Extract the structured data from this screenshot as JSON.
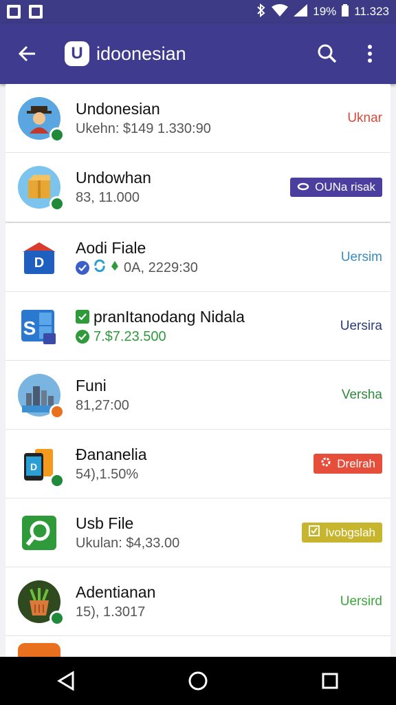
{
  "status_bar": {
    "battery": "19%",
    "time": "11.323"
  },
  "header": {
    "logo_letter": "U",
    "title": "idoonesian"
  },
  "list": [
    {
      "title": "Undonesian",
      "subtitle": "Ukehn: $149 1.330:90",
      "action": "Uknar",
      "action_style": "text",
      "action_color": "#d84a3a",
      "avatar_icon": "person-hat-icon",
      "status_color": "#1f8a3a"
    },
    {
      "title": "Undowhan",
      "subtitle": "83, 11.000",
      "action": "OUNa risak",
      "action_style": "badge",
      "action_color": "#4a3f9e",
      "avatar_icon": "box-icon",
      "status_color": "#1f8a3a"
    },
    {
      "title": "Aodi Fiale",
      "subtitle": "0A, 2229:30",
      "action": "Uersim",
      "action_style": "text",
      "action_color": "#3a8bbf",
      "avatar_icon": "house-app-icon",
      "status_color": ""
    },
    {
      "title": "pranItanodang Nidala",
      "subtitle": "7.$7.23.500",
      "action": "Uersira",
      "action_style": "text",
      "action_color": "#2b3a7a",
      "avatar_icon": "s-app-icon",
      "status_color": ""
    },
    {
      "title": "Funi",
      "subtitle": "81,27:00",
      "action": "Versha",
      "action_style": "text",
      "action_color": "#2e8a3a",
      "avatar_icon": "city-icon",
      "status_color": "#e8701f"
    },
    {
      "title": "Ðananelia",
      "subtitle": "54),1.50%",
      "action": "Drelrah",
      "action_style": "badge",
      "action_color": "#e54e3a",
      "avatar_icon": "phone-icon",
      "status_color": "#1f8a3a"
    },
    {
      "title": "Usb File",
      "subtitle": "Ukulan: $4,33.00",
      "action": "Ivobgslah",
      "action_style": "badge",
      "action_color": "#c7b52e",
      "avatar_icon": "search-app-icon",
      "status_color": ""
    },
    {
      "title": "Adentianan",
      "subtitle": "15), 1.3017",
      "action": "Uersird",
      "action_style": "text",
      "action_color": "#3aa63a",
      "avatar_icon": "basket-icon",
      "status_color": "#1f8a3a"
    }
  ]
}
